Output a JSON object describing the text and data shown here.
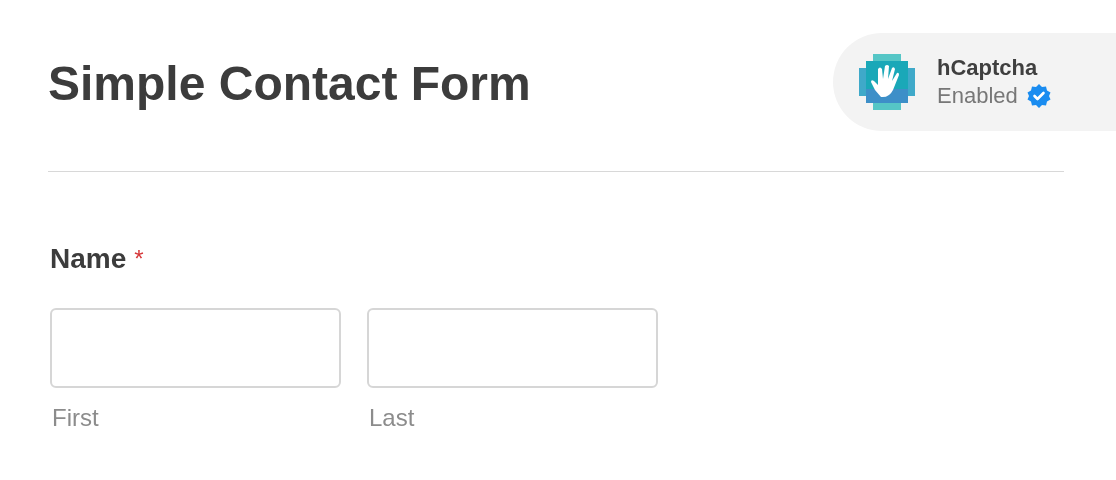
{
  "form_title": "Simple Contact Form",
  "captcha_badge": {
    "name": "hCaptcha",
    "status": "Enabled",
    "verified": true
  },
  "field": {
    "label": "Name",
    "required": true,
    "required_mark": "*",
    "inputs": [
      {
        "sublabel": "First"
      },
      {
        "sublabel": "Last"
      }
    ]
  }
}
